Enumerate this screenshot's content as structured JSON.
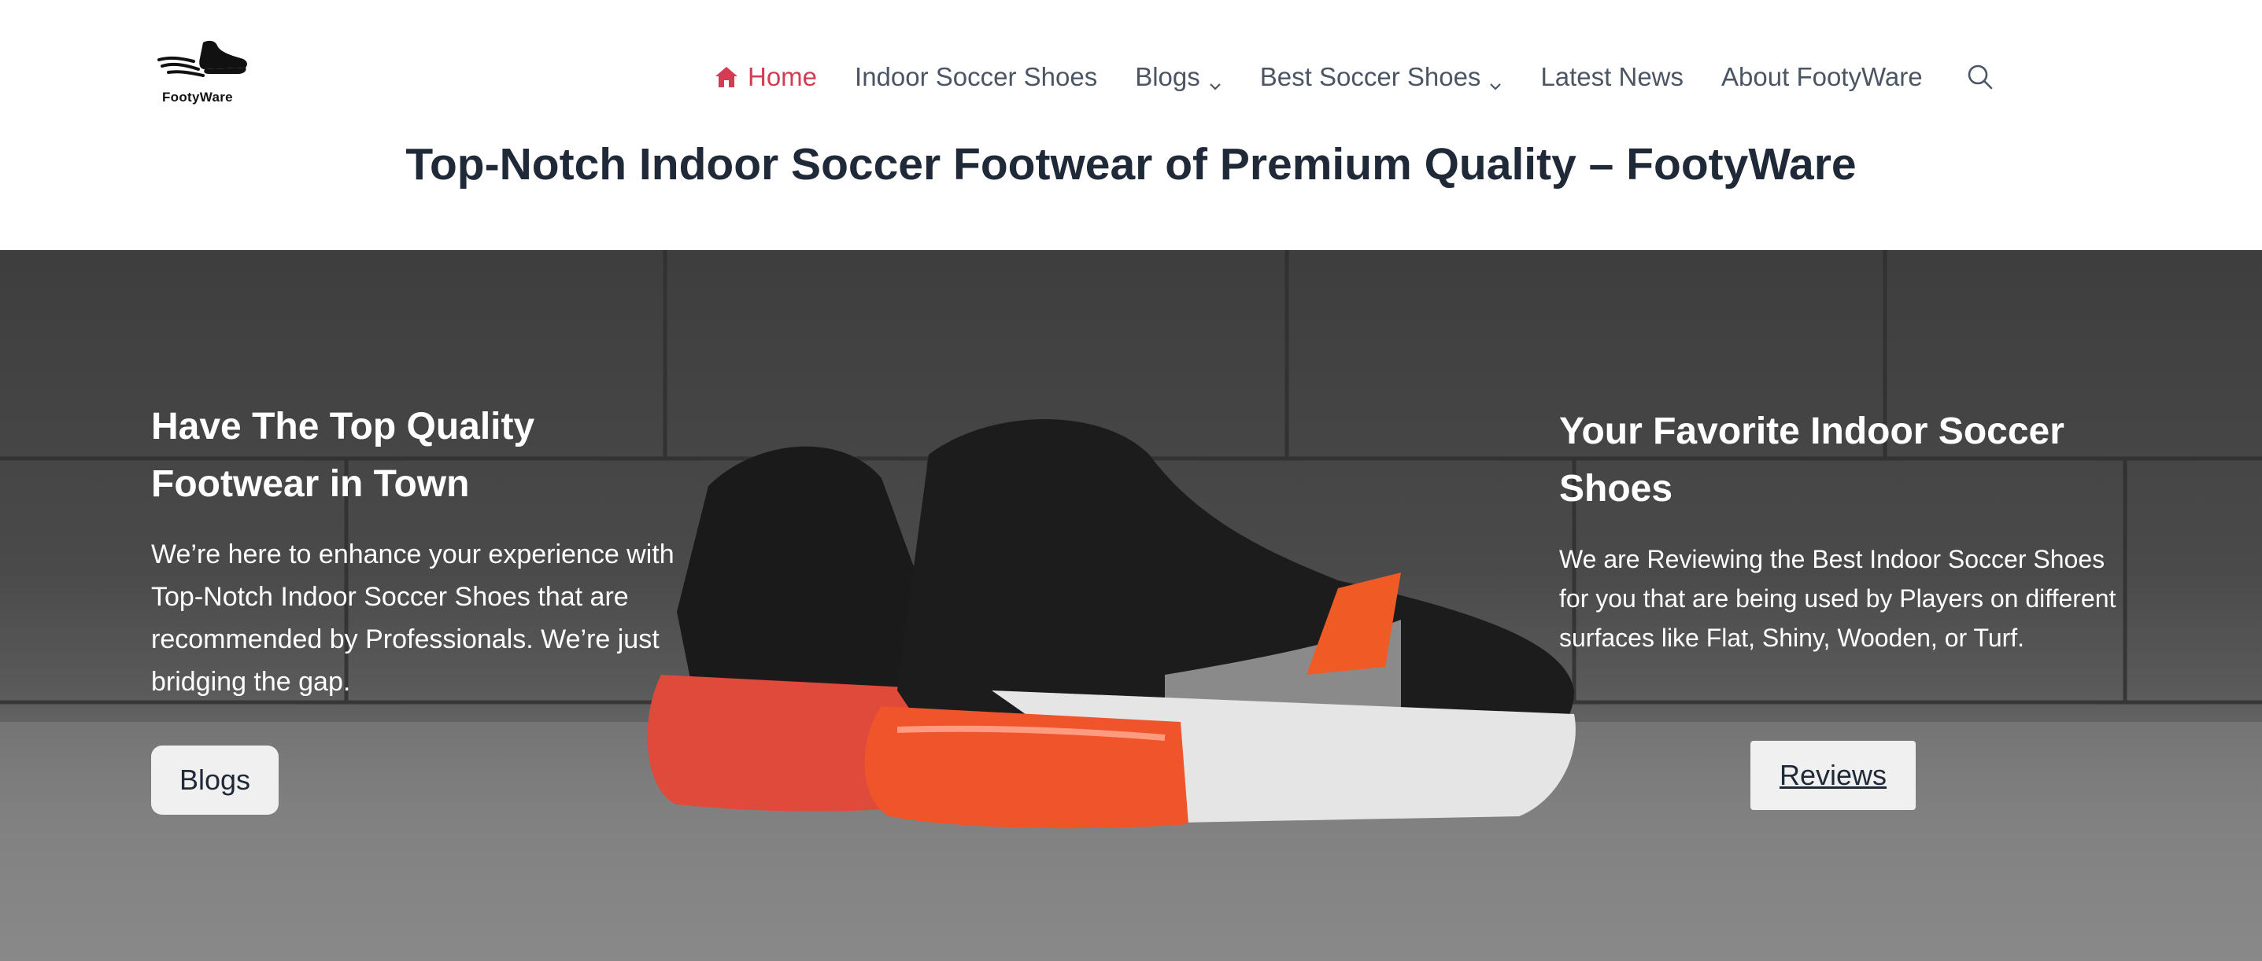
{
  "header": {
    "logo_text": "FootyWare",
    "nav": [
      {
        "label": "Home",
        "active": true,
        "has_dropdown": false
      },
      {
        "label": "Indoor Soccer Shoes",
        "active": false,
        "has_dropdown": false
      },
      {
        "label": "Blogs",
        "active": false,
        "has_dropdown": true
      },
      {
        "label": "Best Soccer Shoes",
        "active": false,
        "has_dropdown": true
      },
      {
        "label": "Latest News",
        "active": false,
        "has_dropdown": false
      },
      {
        "label": "About FootyWare",
        "active": false,
        "has_dropdown": false
      }
    ],
    "search_icon": "search-icon",
    "accent_color": "#d33c52"
  },
  "page_title": "Top-Notch Indoor Soccer Footwear of Premium Quality – FootyWare",
  "hero": {
    "left": {
      "heading": "Have The Top Quality Footwear in Town",
      "body": "We’re here to enhance your experience with Top-Notch Indoor Soccer Shoes that are recommended by Professionals. We’re just bridging the gap.",
      "button_label": "Blogs"
    },
    "right": {
      "heading": "Your Favorite Indoor Soccer Shoes",
      "body": "We are Reviewing the Best Indoor Soccer Shoes for you that are being used by Players on different surfaces like Flat, Shiny, Wooden, or Turf.",
      "button_label": "Reviews"
    }
  }
}
